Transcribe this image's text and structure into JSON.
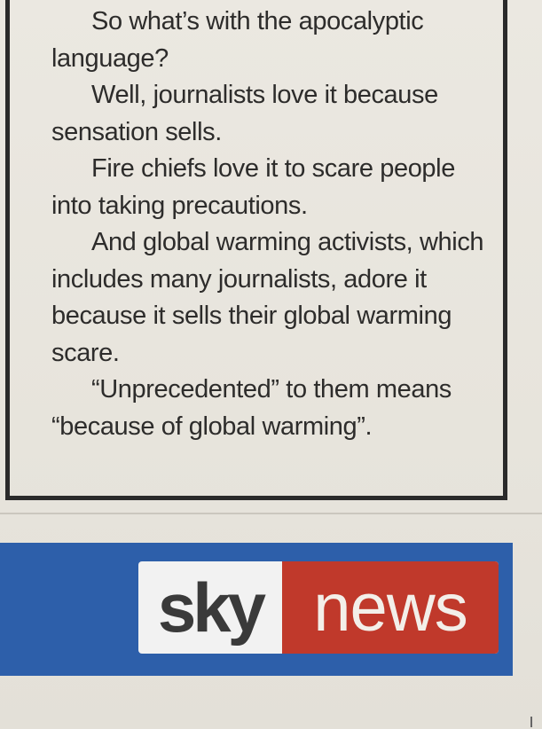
{
  "article": {
    "paragraphs": [
      "So what’s with the apocalyptic language?",
      "Well, journalists love it because sensation sells.",
      "Fire chiefs love it to scare people into taking precautions.",
      "And global warming activists, which includes many journalists, adore it because it sells their global warming scare.",
      "“Unprecedented” to them means “because of global warming”."
    ]
  },
  "logo": {
    "left_text": "sky",
    "right_text": "news"
  },
  "colors": {
    "paper": "#e9e6df",
    "band": "#2d5faa",
    "news_red": "#c0392b",
    "ink": "#2d2c2b"
  }
}
